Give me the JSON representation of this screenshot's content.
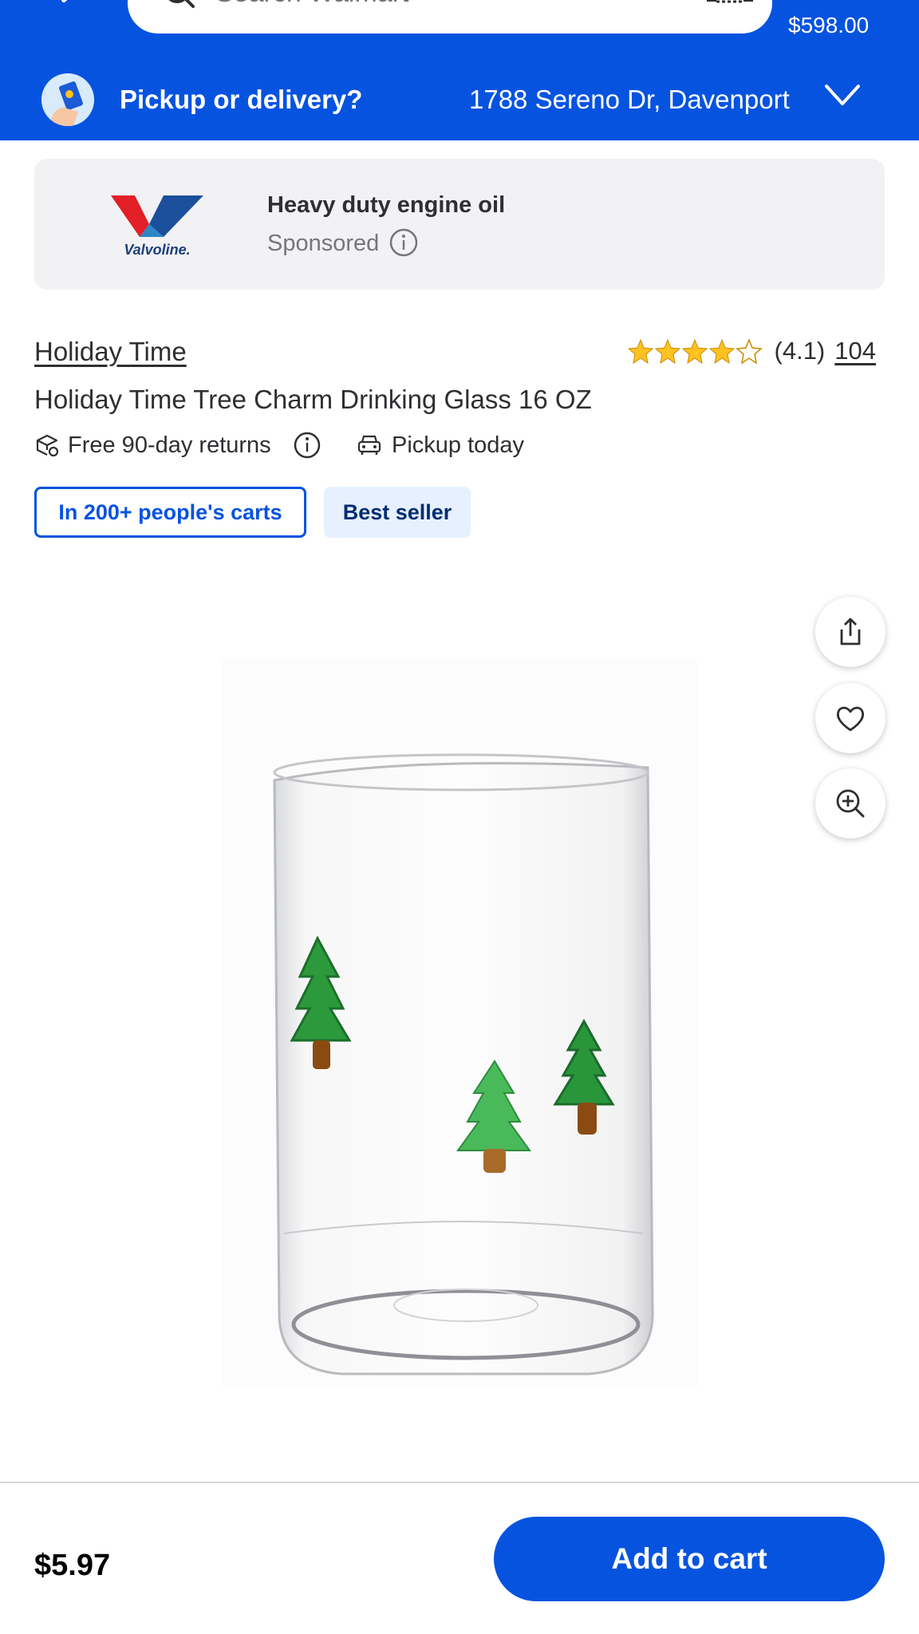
{
  "header": {
    "search_placeholder": "Search Walmart",
    "cart_total": "$598.00",
    "pickup_label": "Pickup or delivery?",
    "address": "1788 Sereno Dr, Davenport",
    "icons": [
      "back-arrow-icon",
      "search-icon",
      "barcode-scan-icon",
      "cart-icon",
      "chevron-down-icon"
    ],
    "background_color": "#0653e0"
  },
  "sponsored_ad": {
    "logo_text": "Valvoline",
    "title": "Heavy duty engine oil",
    "sponsored_label": "Sponsored"
  },
  "product": {
    "brand": "Holiday Time",
    "title": "Holiday Time Tree Charm Drinking Glass 16 OZ",
    "rating_value": "(4.1)",
    "rating_stars": 4.1,
    "review_count": "104",
    "returns": "Free 90-day returns",
    "pickup": "Pickup today",
    "tags": {
      "carts": "In 200+ people's carts",
      "best_seller": "Best seller"
    }
  },
  "image_actions": [
    "share-icon",
    "heart-icon",
    "zoom-in-icon"
  ],
  "bottom_bar": {
    "price": "$5.97",
    "add_to_cart": "Add to cart"
  },
  "colors": {
    "brand_blue": "#0653e0",
    "star": "#ffc220",
    "best_seller_bg": "#e6f0ff",
    "best_seller_text": "#002d72"
  }
}
